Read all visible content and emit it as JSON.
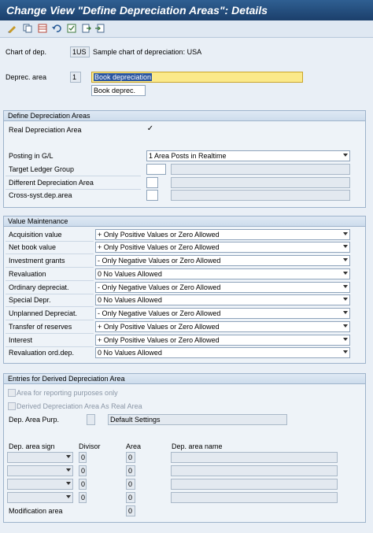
{
  "window": {
    "title": "Change View \"Define Depreciation Areas\": Details"
  },
  "toolbar": {
    "icons": [
      "edit-icon",
      "copy-icon",
      "table-icon",
      "undo-icon",
      "detail-icon",
      "export-icon",
      "import-icon"
    ]
  },
  "header": {
    "chart_label": "Chart of dep.",
    "chart_value": "1US",
    "chart_desc": "Sample chart of depreciation: USA",
    "area_label": "Deprec. area",
    "area_value": "1",
    "area_name": "Book depreciation",
    "area_short": "Book deprec."
  },
  "define_group": {
    "title": "Define Depreciation Areas",
    "real_label": "Real Depreciation Area",
    "real_checked": "✓",
    "posting_label": "Posting in G/L",
    "posting_value": "1 Area Posts in Realtime",
    "target_label": "Target Ledger Group",
    "diff_label": "Different Depreciation Area",
    "cross_label": "Cross-syst.dep.area"
  },
  "value_group": {
    "title": "Value Maintenance",
    "rows": [
      {
        "label": "Acquisition value",
        "value": "+ Only Positive Values or Zero Allowed"
      },
      {
        "label": "Net book value",
        "value": "+ Only Positive Values or Zero Allowed"
      },
      {
        "label": "Investment grants",
        "value": "- Only Negative Values or Zero Allowed"
      },
      {
        "label": "Revaluation",
        "value": "0 No Values Allowed"
      },
      {
        "label": "Ordinary depreciat.",
        "value": "- Only Negative Values or Zero Allowed"
      },
      {
        "label": "Special Depr.",
        "value": "0 No Values Allowed"
      },
      {
        "label": "Unplanned Depreciat.",
        "value": "- Only Negative Values or Zero Allowed"
      },
      {
        "label": "Transfer of reserves",
        "value": "+ Only Positive Values or Zero Allowed"
      },
      {
        "label": "Interest",
        "value": "+ Only Positive Values or Zero Allowed"
      },
      {
        "label": "Revaluation ord.dep.",
        "value": "0 No Values Allowed"
      }
    ]
  },
  "derived_group": {
    "title": "Entries for Derived Depreciation Area",
    "reporting_label": "Area for reporting purposes only",
    "derived_label": "Derived Depreciation Area As Real Area",
    "purp_label": "Dep. Area Purp.",
    "purp_value": "Default Settings",
    "col_sign": "Dep. area sign",
    "col_divisor": "Divisor",
    "col_area": "Area",
    "col_name": "Dep. area name",
    "rows": [
      {
        "divisor": "0",
        "area": "0"
      },
      {
        "divisor": "0",
        "area": "0"
      },
      {
        "divisor": "0",
        "area": "0"
      },
      {
        "divisor": "0",
        "area": "0"
      }
    ],
    "modification_label": "Modification area",
    "modification_value": "0"
  }
}
